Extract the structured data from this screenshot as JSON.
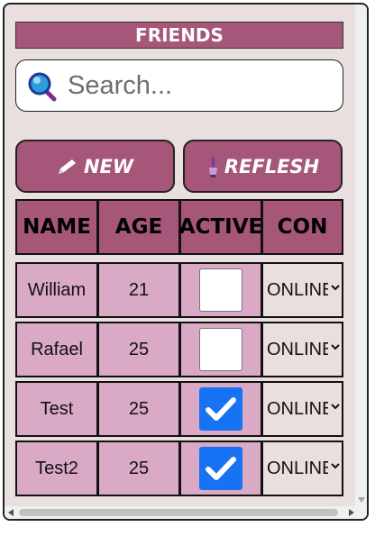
{
  "header": {
    "title": "FRIENDS"
  },
  "search": {
    "placeholder": "Search..."
  },
  "toolbar": {
    "new_label": "NEW",
    "refresh_label": "REFLESH"
  },
  "table": {
    "columns": [
      "NAME",
      "AGE",
      "ACTIVE",
      "CON"
    ],
    "rows": [
      {
        "name": "William",
        "age": "21",
        "active": false,
        "con": "ONLINE"
      },
      {
        "name": "Rafael",
        "age": "25",
        "active": false,
        "con": "ONLINE"
      },
      {
        "name": "Test",
        "age": "25",
        "active": true,
        "con": "ONLINE"
      },
      {
        "name": "Test2",
        "age": "25",
        "active": true,
        "con": "ONLINE"
      }
    ]
  },
  "colors": {
    "accent": "#a65678",
    "row_bg": "#d9a9c6",
    "panel_bg": "#eadfdf",
    "checkbox_checked": "#1773f4"
  },
  "icons": {
    "search": "magnifier-icon",
    "new": "pencil-icon",
    "refresh": "brush-icon",
    "dropdown": "chevron-down-icon",
    "checkmark": "checkmark-icon"
  }
}
